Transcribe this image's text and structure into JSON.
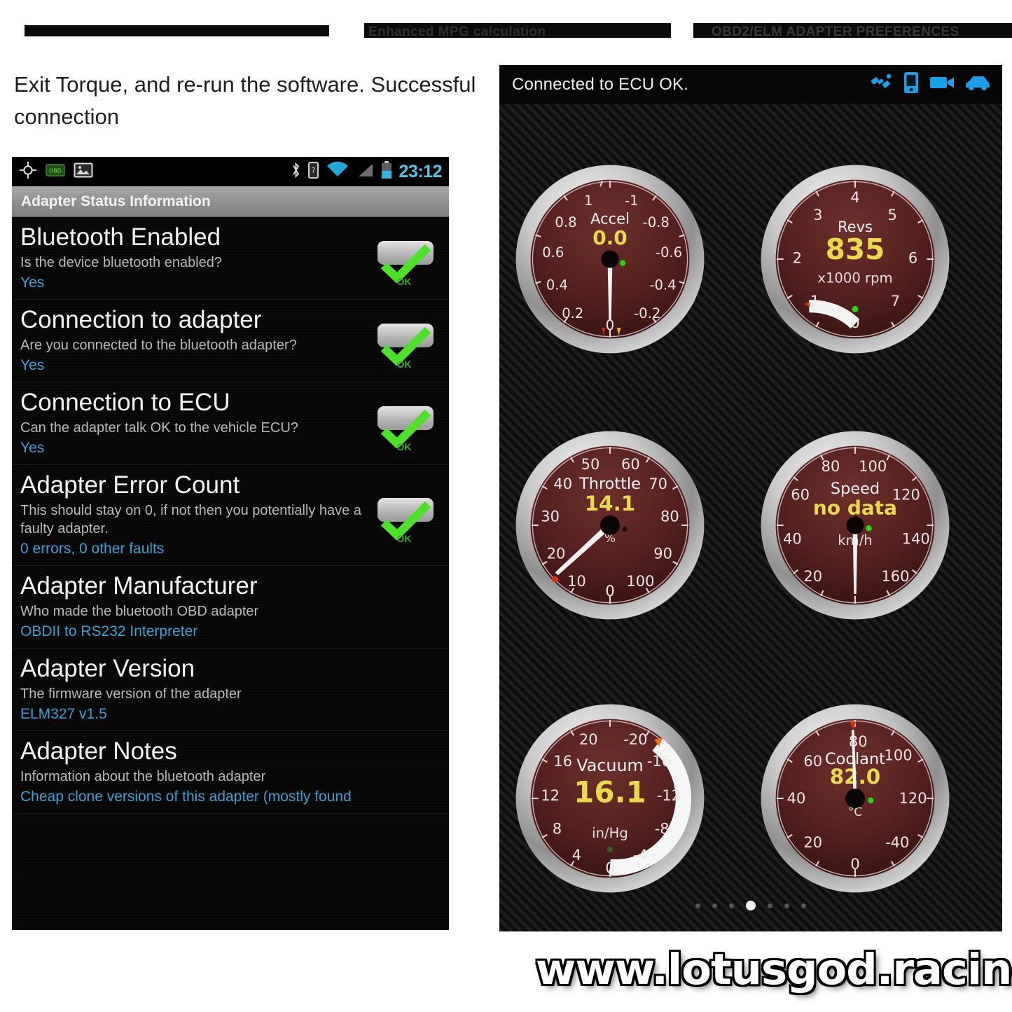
{
  "top_headers": {
    "header_left": "",
    "header_middle": "Enhanced MPG calculation",
    "header_right": "OBD2/ELM ADAPTER PREFERENCES"
  },
  "caption": "Exit Torque, and re-run the software. Successful connection",
  "phone": {
    "status_bar": {
      "time": "23:12",
      "left_icons": [
        "gps-crosshair-icon",
        "obd-adapter-icon",
        "image-icon"
      ],
      "right_icons": [
        "bluetooth-icon",
        "sim-card-icon",
        "wifi-icon",
        "signal-icon",
        "battery-icon"
      ]
    },
    "title": "Adapter Status Information",
    "rows": [
      {
        "heading": "Bluetooth Enabled",
        "description": "Is the device bluetooth enabled?",
        "value": "Yes",
        "status_icon": "green-check-icon",
        "status_label": "OK"
      },
      {
        "heading": "Connection to adapter",
        "description": "Are you connected to the bluetooth adapter?",
        "value": "Yes",
        "status_icon": "green-check-icon",
        "status_label": "OK"
      },
      {
        "heading": "Connection to ECU",
        "description": "Can the adapter talk OK to the vehicle ECU?",
        "value": "Yes",
        "status_icon": "green-check-icon",
        "status_label": "OK"
      },
      {
        "heading": "Adapter Error Count",
        "description": "This should stay on 0, if not then you potentially have a faulty adapter.",
        "value": "0 errors, 0 other faults",
        "status_icon": "green-check-icon",
        "status_label": "OK"
      },
      {
        "heading": "Adapter Manufacturer",
        "description": "Who made the bluetooth OBD adapter",
        "value": "OBDII to RS232 Interpreter",
        "status_icon": "",
        "status_label": ""
      },
      {
        "heading": "Adapter Version",
        "description": "The firmware version of the adapter",
        "value": "ELM327 v1.5",
        "status_icon": "",
        "status_label": ""
      },
      {
        "heading": "Adapter Notes",
        "description": "Information about the bluetooth adapter",
        "value": "Cheap clone versions of this adapter (mostly found",
        "status_icon": "",
        "status_label": ""
      }
    ]
  },
  "torque": {
    "status_text": "Connected to ECU OK.",
    "status_icons": [
      "satellite-icon",
      "phone-icon",
      "video-camera-icon",
      "car-icon"
    ],
    "accent_value_color": "#e9d94a",
    "page_dots_total": 7,
    "page_dots_active_index": 3,
    "gauges": [
      {
        "name": "Accel",
        "value": "0.0",
        "unit": "",
        "ticks_left": [
          "1",
          "0.8",
          "0.6",
          "0.4",
          "0.2"
        ],
        "ticks_right": [
          "-1",
          "-0.8",
          "-0.6",
          "-0.4",
          "-0.2"
        ],
        "tick_bottom": "0",
        "needle_angle": 0,
        "arc_sweep": 0,
        "has_green_led": true,
        "min_marker": "red",
        "max_marker": "orange"
      },
      {
        "name": "Revs",
        "value": "835",
        "unit": "x1000 rpm",
        "ticks_left": [
          "4",
          "3",
          "2",
          "1"
        ],
        "ticks_right": [
          "5",
          "6",
          "7"
        ],
        "tick_bottom": "0",
        "needle_angle": -158,
        "arc_sweep": 22,
        "has_green_led": true,
        "min_marker": "red",
        "max_marker": ""
      },
      {
        "name": "Throttle",
        "value": "14.1",
        "unit": "%",
        "ticks_left": [
          "50",
          "40",
          "30",
          "20",
          "10"
        ],
        "ticks_right": [
          "60",
          "70",
          "80",
          "90",
          "100"
        ],
        "tick_bottom": "0",
        "needle_angle": -140,
        "arc_sweep": 0,
        "has_green_led": false,
        "min_marker": "red",
        "max_marker": ""
      },
      {
        "name": "Speed",
        "value": "no data",
        "unit": "km/h",
        "ticks_left": [
          "80",
          "60",
          "40",
          "20"
        ],
        "ticks_right": [
          "100",
          "120",
          "140",
          "160"
        ],
        "tick_bottom": "",
        "needle_angle": 0,
        "arc_sweep": 0,
        "has_green_led": true,
        "min_marker": "",
        "max_marker": ""
      },
      {
        "name": "Vacuum",
        "value": "16.1",
        "unit": "in/Hg",
        "ticks_left": [
          "20",
          "16",
          "12",
          "8",
          "4"
        ],
        "ticks_right": [
          "-20",
          "-16",
          "-12",
          "-8",
          "-4"
        ],
        "tick_bottom": "0",
        "needle_angle": 0,
        "arc_sweep": 142,
        "has_green_led": true,
        "min_marker": "",
        "max_marker": "orange"
      },
      {
        "name": "Coolant",
        "value": "82.0",
        "unit": "°C",
        "ticks_left": [
          "80",
          "60",
          "40",
          "20"
        ],
        "ticks_right": [
          "100",
          "120",
          "-40"
        ],
        "tick_bottom": "0",
        "needle_angle": 176,
        "arc_sweep": 0,
        "has_green_led": true,
        "min_marker": "",
        "max_marker": "red-top"
      }
    ]
  },
  "watermark": "www.lotusgod.racing"
}
